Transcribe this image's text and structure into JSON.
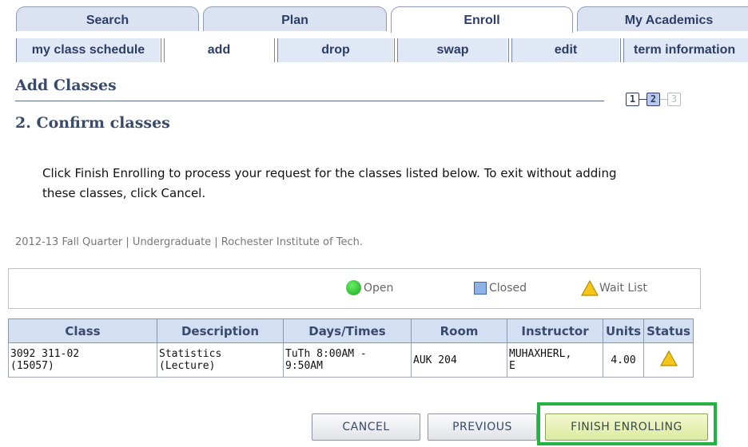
{
  "main_tabs": [
    {
      "label": "Search"
    },
    {
      "label": "Plan"
    },
    {
      "label": "Enroll"
    },
    {
      "label": "My Academics"
    }
  ],
  "sub_tabs": [
    {
      "label": "my class schedule"
    },
    {
      "label": "add"
    },
    {
      "label": "drop"
    },
    {
      "label": "swap"
    },
    {
      "label": "edit"
    },
    {
      "label": "term information"
    }
  ],
  "page": {
    "title": "Add Classes",
    "steps": [
      "1",
      "2",
      "3"
    ],
    "current_step": 2,
    "subtitle": "2.  Confirm classes",
    "instructions": "Click Finish Enrolling to process your request for the classes listed below. To exit without adding these classes, click Cancel.",
    "term_line": "2012-13 Fall Quarter | Undergraduate | Rochester Institute of Tech."
  },
  "legend": {
    "open": "Open",
    "closed": "Closed",
    "wait_list": "Wait List",
    "colors": {
      "open": "#22b322",
      "closed": "#8fb3e6",
      "wait_list": "#f5c518"
    }
  },
  "table": {
    "headers": [
      "Class",
      "Description",
      "Days/Times",
      "Room",
      "Instructor",
      "Units",
      "Status"
    ],
    "row": {
      "class_line1": "3092 311-02",
      "class_line2": "(15057)",
      "description_line1": "Statistics",
      "description_line2": "(Lecture)",
      "days_times_line1": "TuTh 8:00AM -",
      "days_times_line2": "9:50AM",
      "room": "AUK 204",
      "instructor_line1": "MUHAXHERL,",
      "instructor_line2": "E",
      "units": "4.00",
      "status_icon": "wait-list-triangle-icon"
    }
  },
  "buttons": {
    "cancel": "CANCEL",
    "previous": "PREVIOUS",
    "finish": "FINISH ENROLLING"
  }
}
